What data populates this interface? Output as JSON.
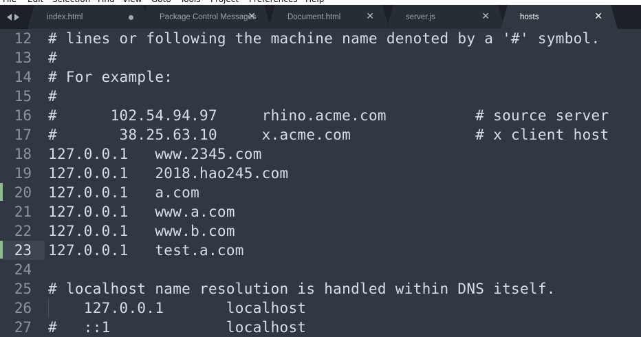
{
  "menu": [
    "File",
    "Edit",
    "Selection",
    "Find",
    "View",
    "Goto",
    "Tools",
    "Project",
    "Preferences",
    "Help"
  ],
  "tabs": [
    {
      "label": "index.html",
      "indicator": "dot",
      "active": false
    },
    {
      "label": "Package Control Messages",
      "indicator": "close",
      "active": false
    },
    {
      "label": "Document.html",
      "indicator": "close",
      "active": false
    },
    {
      "label": "server.js",
      "indicator": "close",
      "active": false
    },
    {
      "label": "hosts",
      "indicator": "close",
      "active": true
    }
  ],
  "close_glyph": "✕",
  "lines": [
    {
      "num": "12",
      "text": "# lines or following the machine name denoted by a '#' symbol."
    },
    {
      "num": "13",
      "text": "#"
    },
    {
      "num": "14",
      "text": "# For example:"
    },
    {
      "num": "15",
      "text": "#"
    },
    {
      "num": "16",
      "text": "#      102.54.94.97     rhino.acme.com          # source server"
    },
    {
      "num": "17",
      "text": "#       38.25.63.10     x.acme.com              # x client host"
    },
    {
      "num": "18",
      "text": "127.0.0.1   www.2345.com"
    },
    {
      "num": "19",
      "text": "127.0.0.1   2018.hao245.com"
    },
    {
      "num": "20",
      "text": "127.0.0.1   a.com",
      "modified": true
    },
    {
      "num": "21",
      "text": "127.0.0.1   www.a.com"
    },
    {
      "num": "22",
      "text": "127.0.0.1   www.b.com"
    },
    {
      "num": "23",
      "text": "127.0.0.1   test.a.com",
      "modified": true,
      "current": true
    },
    {
      "num": "24",
      "text": ""
    },
    {
      "num": "25",
      "text": "# localhost name resolution is handled within DNS itself."
    },
    {
      "num": "26",
      "text": "    127.0.0.1       localhost",
      "indent_guide": true
    },
    {
      "num": "27",
      "text": "#   ::1             localhost"
    }
  ]
}
